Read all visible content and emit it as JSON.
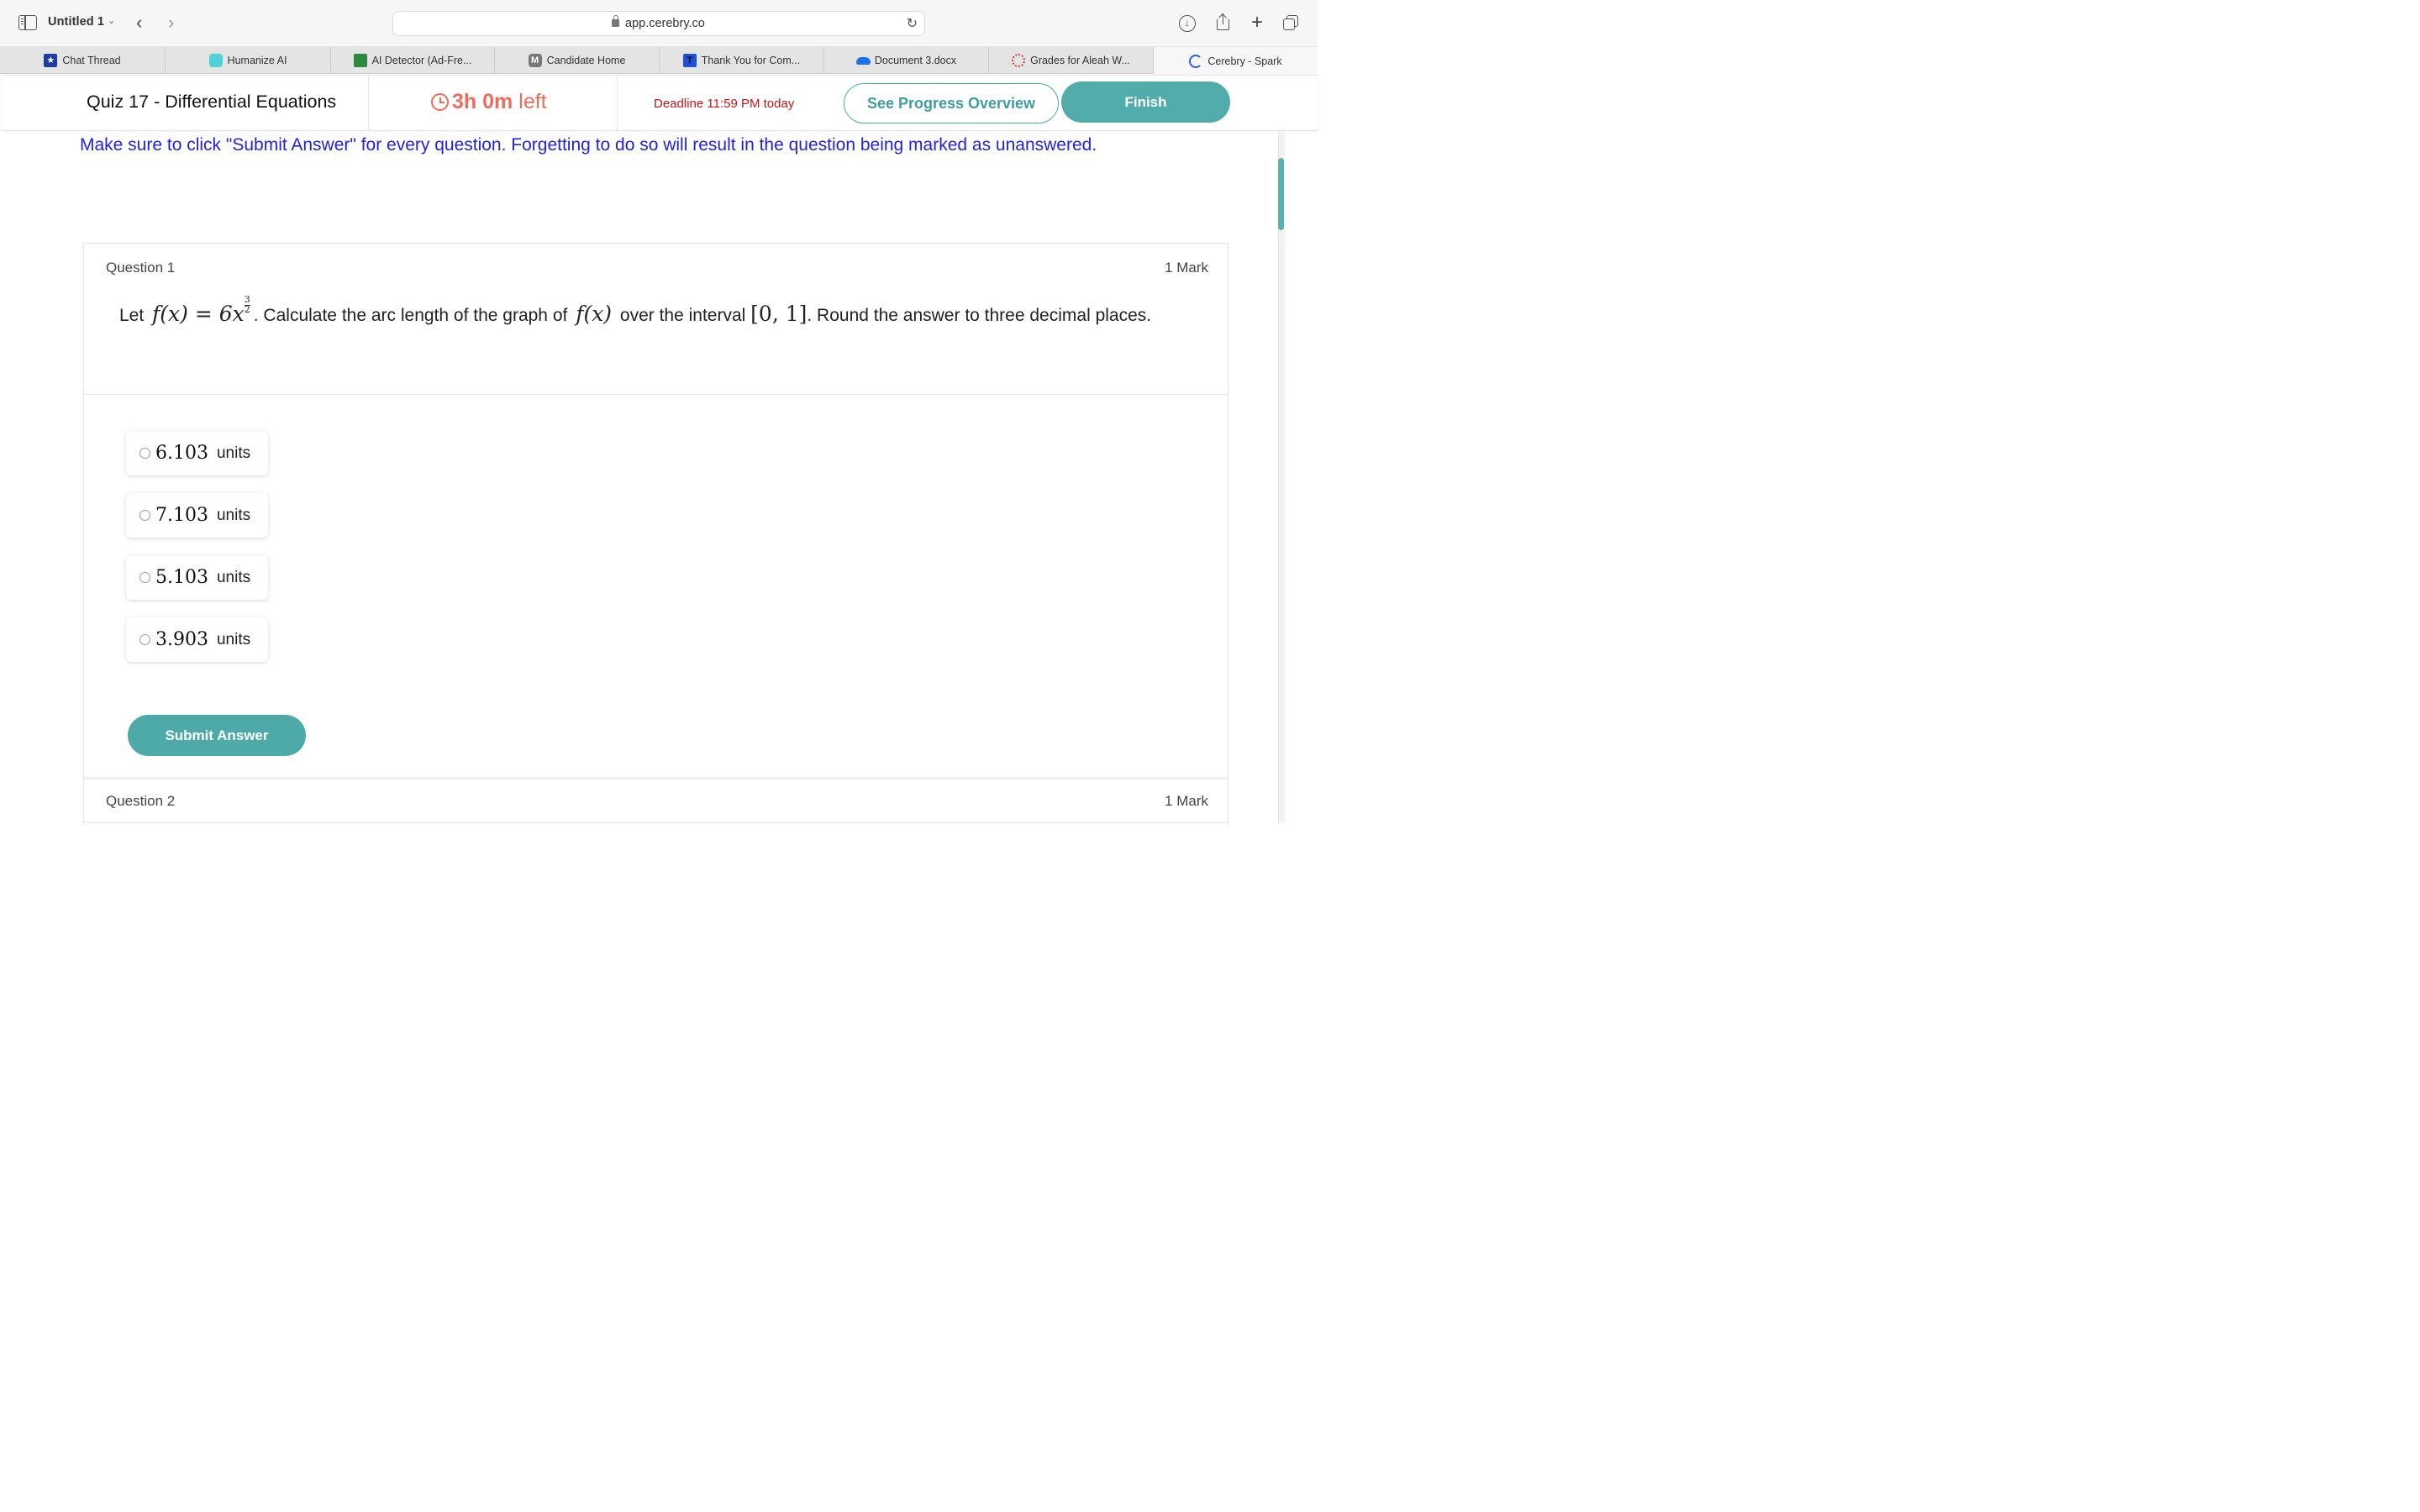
{
  "browser": {
    "window_title": "Untitled 1",
    "url": "app.cerebry.co",
    "tabs": [
      {
        "label": "Chat Thread"
      },
      {
        "label": "Humanize AI"
      },
      {
        "label": "AI Detector (Ad-Fre..."
      },
      {
        "label": "Candidate Home"
      },
      {
        "label": "Thank You for Com..."
      },
      {
        "label": "Document 3.docx"
      },
      {
        "label": "Grades for Aleah W..."
      },
      {
        "label": "Cerebry - Spark"
      }
    ]
  },
  "quiz": {
    "title": "Quiz 17 - Differential Equations",
    "timer_value": "3h 0m",
    "timer_suffix": "left",
    "deadline": "Deadline 11:59 PM today",
    "progress_button": "See Progress Overview",
    "finish_button": "Finish"
  },
  "notice": "Make sure to click \"Submit Answer\" for every question. Forgetting to do so will result in the question being marked as unanswered.",
  "question1": {
    "label": "Question 1",
    "marks": "1 Mark",
    "text_let": "Let",
    "text_func": "f(x) = 6x",
    "text_exp_num": "3",
    "text_exp_den": "2",
    "text_part1": ". Calculate the arc length of the graph of",
    "text_fx": "f(x)",
    "text_part2": "over the interval",
    "text_interval": "[0, 1]",
    "text_part3": ". Round the answer to three decimal places.",
    "options": [
      {
        "value": "6.103",
        "unit": "units"
      },
      {
        "value": "7.103",
        "unit": "units"
      },
      {
        "value": "5.103",
        "unit": "units"
      },
      {
        "value": "3.903",
        "unit": "units"
      }
    ],
    "submit_button": "Submit Answer"
  },
  "question2": {
    "label": "Question 2",
    "marks": "1 Mark"
  },
  "colors": {
    "accent": "#52acac",
    "timer": "#ef6b5c",
    "deadline": "#c81414",
    "notice": "#2222dd"
  }
}
